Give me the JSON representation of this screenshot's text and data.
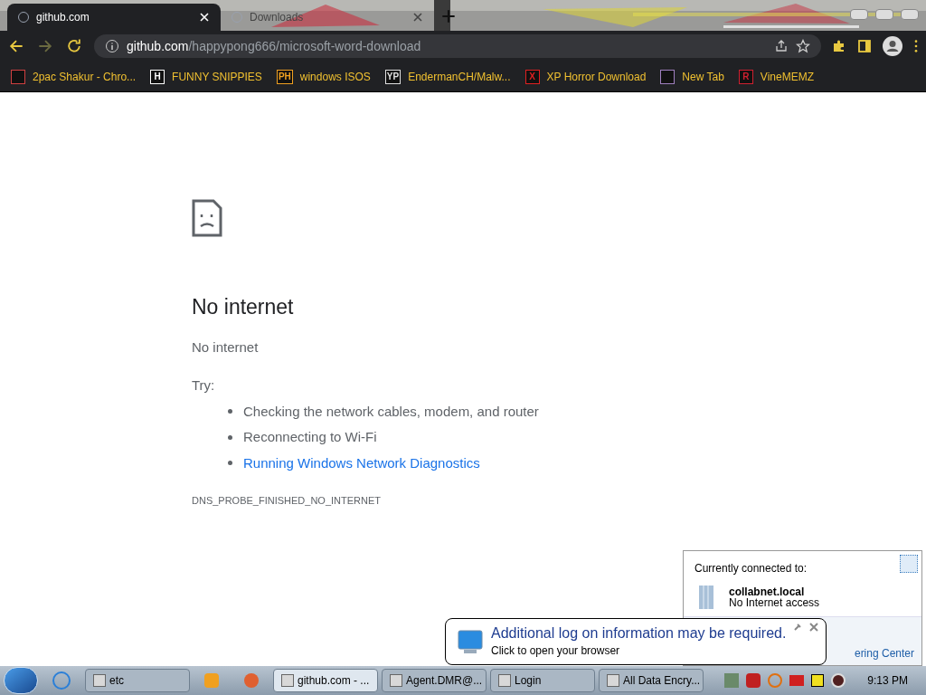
{
  "tabs": [
    {
      "label": "github.com",
      "selected": true
    },
    {
      "label": "Downloads",
      "selected": false
    }
  ],
  "address": {
    "host": "github.com",
    "path": "/happypong666/microsoft-word-download"
  },
  "bookmarks": [
    {
      "label": "2pac Shakur - Chro...",
      "color": "#d04040"
    },
    {
      "label": "FUNNY SNIPPIES",
      "badge": "H",
      "color": "#ffffff"
    },
    {
      "label": "windows ISOS",
      "badge": "PH",
      "color": "#f0a020"
    },
    {
      "label": "EndermanCH/Malw...",
      "badge": "YP",
      "color": "#e0e0e0"
    },
    {
      "label": "XP Horror Download",
      "badge": "X",
      "color": "#e02020"
    },
    {
      "label": "New Tab",
      "color": "#a080c0"
    },
    {
      "label": "VineMEMZ",
      "badge": "R",
      "color": "#d02030"
    }
  ],
  "error": {
    "title": "No internet",
    "subtitle": "No internet",
    "try": "Try:",
    "suggestions": [
      {
        "text": "Checking the network cables, modem, and router",
        "kind": "text"
      },
      {
        "text": "Reconnecting to Wi-Fi",
        "kind": "text"
      },
      {
        "text": "Running Windows Network Diagnostics",
        "kind": "link"
      }
    ],
    "code": "DNS_PROBE_FINISHED_NO_INTERNET"
  },
  "network_popup": {
    "heading": "Currently connected to:",
    "network": "collabnet.local",
    "status": "No Internet access",
    "link": "ering Center"
  },
  "balloon": {
    "title": "Additional log on information may be required.",
    "body": "Click to open your browser"
  },
  "taskbar": {
    "items": [
      {
        "label": "etc",
        "selected": false
      },
      {
        "label": "github.com - ...",
        "selected": true
      },
      {
        "label": "Agent.DMR@...",
        "selected": false
      },
      {
        "label": "Login",
        "selected": false
      },
      {
        "label": "All Data Encry...",
        "selected": false
      }
    ],
    "clock": "9:13 PM"
  }
}
